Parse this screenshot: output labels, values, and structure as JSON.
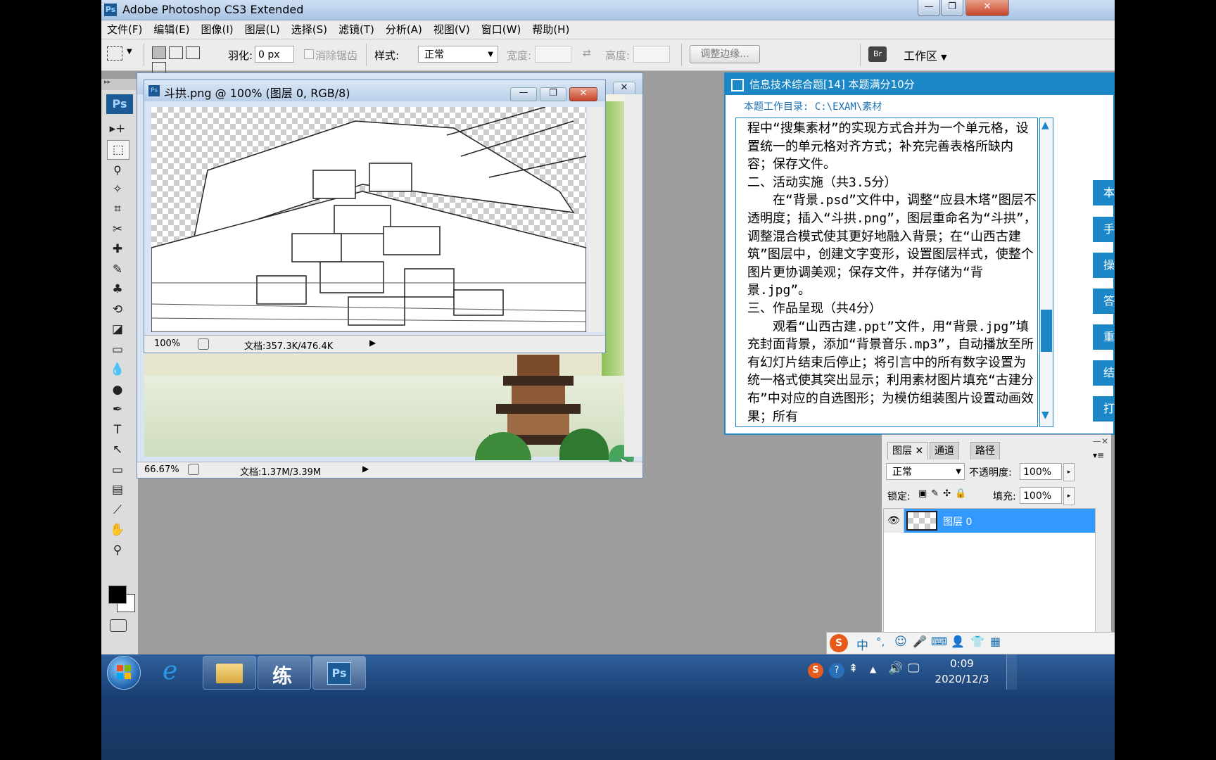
{
  "window": {
    "title": "Adobe Photoshop CS3 Extended",
    "app_icon": "Ps",
    "min": "—",
    "max": "❐",
    "close": "✕"
  },
  "menu": [
    "文件(F)",
    "编辑(E)",
    "图像(I)",
    "图层(L)",
    "选择(S)",
    "滤镜(T)",
    "分析(A)",
    "视图(V)",
    "窗口(W)",
    "帮助(H)"
  ],
  "options": {
    "feather_label": "羽化:",
    "feather_value": "0 px",
    "antialias_label": "消除锯齿",
    "style_label": "样式:",
    "style_value": "正常",
    "width_label": "宽度:",
    "height_label": "高度:",
    "refine_edge": "调整边缘...",
    "workspace": "工作区"
  },
  "toolbox": {
    "logo": "Ps",
    "tools": [
      "move-icon",
      "marquee-icon",
      "lasso-icon",
      "magic-wand-icon",
      "crop-icon",
      "slice-icon",
      "healing-brush-icon",
      "brush-icon",
      "clone-stamp-icon",
      "history-brush-icon",
      "eraser-icon",
      "gradient-icon",
      "blur-icon",
      "dodge-icon",
      "pen-icon",
      "type-icon",
      "path-selection-icon",
      "shape-icon",
      "notes-icon",
      "eyedropper-icon",
      "hand-icon",
      "zoom-icon"
    ],
    "glyphs": [
      "▸+",
      "⬚",
      "ϙ",
      "✧",
      "⌗",
      "✂",
      "✚",
      "✎",
      "♣",
      "⟲",
      "◪",
      "▭",
      "💧",
      "●",
      "✒",
      "T",
      "↖",
      "▭",
      "▤",
      "⟋",
      "✋",
      "⚲"
    ],
    "foreground_color": "#000000",
    "background_color": "#ffffff"
  },
  "doc_bg": {
    "zoom": "66.67%",
    "doc_size": "文档:1.37M/3.39M"
  },
  "doc_front": {
    "title": "斗拱.png @ 100% (图层 0, RGB/8)",
    "zoom": "100%",
    "doc_size": "文档:357.3K/476.4K"
  },
  "exam": {
    "title": "信息技术综合题[14]   本题满分10分",
    "dir": "本题工作目录: C:\\EXAM\\素材",
    "paragraphs": [
      "程中“搜集素材”的实现方式合并为一个单元格，设置统一的单元格对齐方式；补充完善表格所缺内容；保存文件。",
      "二、活动实施（共3.5分）",
      "　　在“背景.psd”文件中，调整“应县木塔”图层不透明度；插入“斗拱.png”，图层重命名为“斗拱”，调整混合模式使其更好地融入背景；在“山西古建筑”图层中，创建文字变形，设置图层样式，使整个图片更协调美观；保存文件，并存储为“背景.jpg”。",
      "三、作品呈现（共4分）",
      "　　观看“山西古建.ppt”文件，用“背景.jpg”填充封面背景，添加“背景音乐.mp3”，自动播放至所有幻灯片结束后停止；将引言中的所有数字设置为统一格式使其突出显示；利用素材图片填充“古建分布”中对应的自选图形；为模仿组装图片设置动画效果；所有"
    ],
    "side_buttons": [
      "本",
      "手",
      "操",
      "答",
      "重",
      "结",
      "打"
    ]
  },
  "layers_panel": {
    "tabs": [
      "图层",
      "通道",
      "路径"
    ],
    "blend_mode": "正常",
    "opacity_label": "不透明度:",
    "opacity_value": "100%",
    "lock_label": "锁定:",
    "fill_label": "填充:",
    "fill_value": "100%",
    "layer_name": "图层 0"
  },
  "ime": {
    "items": [
      "S",
      "中",
      "°,",
      "☺",
      "🎤",
      "⌨",
      "👤",
      "👕",
      "▦"
    ]
  },
  "taskbar": {
    "apps": [
      "ie-icon",
      "explorer-icon",
      "练",
      "Ps"
    ],
    "time": "0:09",
    "date": "2020/12/3"
  },
  "colors": {
    "accent": "#1b87c7",
    "selected_layer": "#3399ff"
  }
}
